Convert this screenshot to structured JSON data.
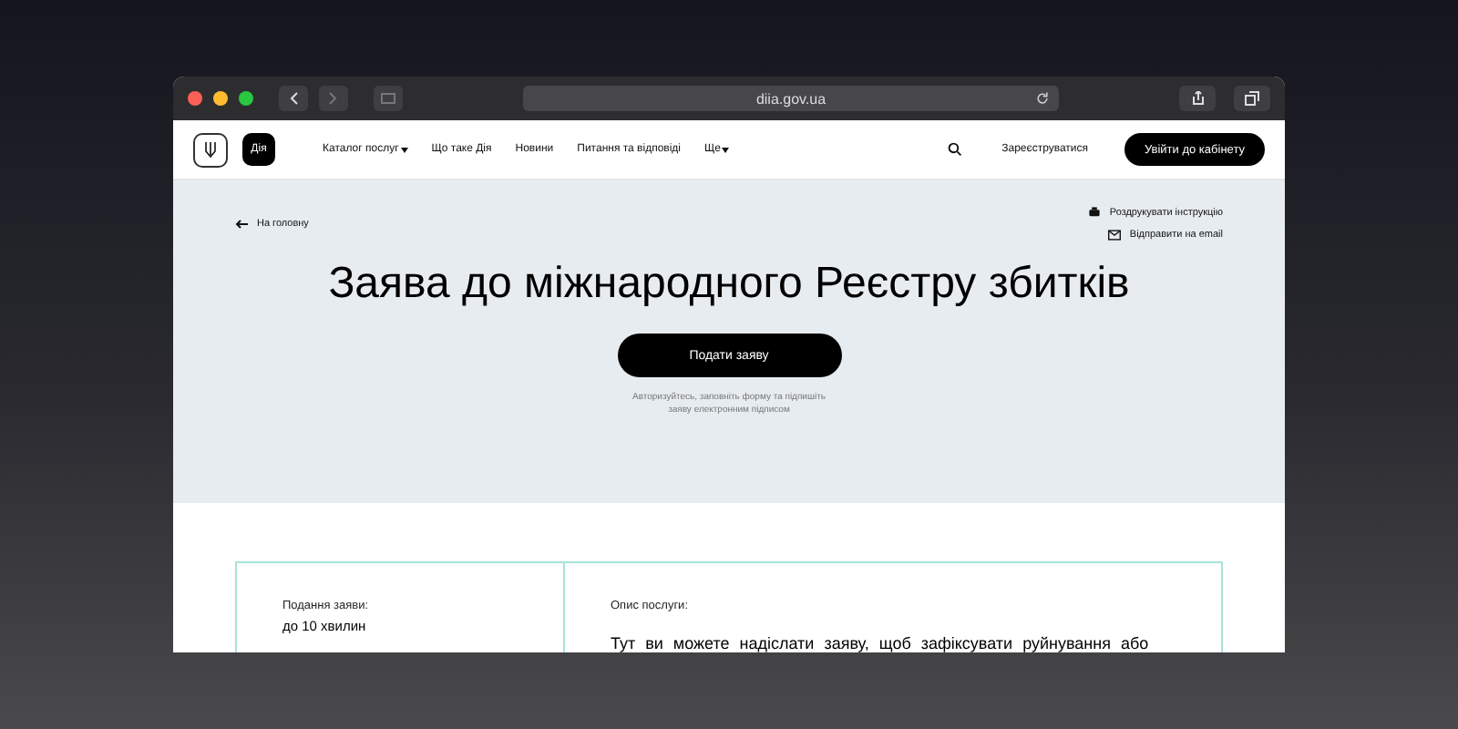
{
  "browser": {
    "url": "diia.gov.ua"
  },
  "nav": {
    "logo_text": "Дія",
    "items": [
      {
        "label": "Каталог послуг",
        "dropdown": true
      },
      {
        "label": "Що таке Дія",
        "dropdown": false
      },
      {
        "label": "Новини",
        "dropdown": false
      },
      {
        "label": "Питання та відповіді",
        "dropdown": false
      },
      {
        "label": "Ще",
        "dropdown": true
      }
    ],
    "register": "Зареєструватися",
    "login": "Увійти до кабінету"
  },
  "hero": {
    "back": "На головну",
    "actions": [
      {
        "kind": "print",
        "label": "Роздрукувати інструкцію"
      },
      {
        "kind": "email",
        "label": "Відправити на email"
      }
    ],
    "title": "Заява до міжнародного Реєстру збитків",
    "button": "Подати заяву",
    "note": "Авторизуйтесь, заповніть форму та підпишіть заяву електронним підписом"
  },
  "card": {
    "duration_label": "Подання заяви:",
    "duration_value": "до 10 хвилин",
    "description_label": "Опис послуги:",
    "description": "Тут ви можете надіслати заяву, щоб зафіксувати руйнування або"
  }
}
